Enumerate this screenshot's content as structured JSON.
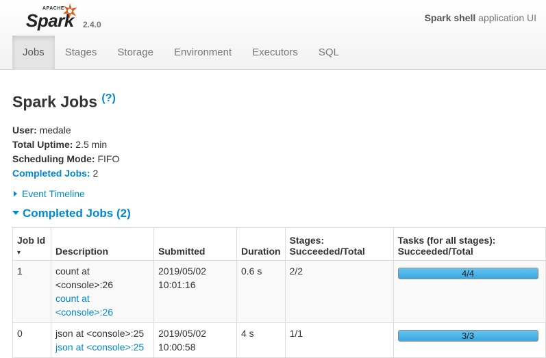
{
  "header": {
    "logo_apache": "APACHE",
    "logo_spark": "Spark",
    "version": "2.4.0",
    "app_name": "Spark shell",
    "app_suffix": " application UI"
  },
  "tabs": [
    {
      "label": "Jobs",
      "active": true
    },
    {
      "label": "Stages",
      "active": false
    },
    {
      "label": "Storage",
      "active": false
    },
    {
      "label": "Environment",
      "active": false
    },
    {
      "label": "Executors",
      "active": false
    },
    {
      "label": "SQL",
      "active": false
    }
  ],
  "page": {
    "title": "Spark Jobs",
    "help_open": "(",
    "help_q": "?",
    "help_close": ")"
  },
  "summary": {
    "user_label": "User:",
    "user_value": "medale",
    "uptime_label": "Total Uptime:",
    "uptime_value": "2.5 min",
    "mode_label": "Scheduling Mode:",
    "mode_value": "FIFO",
    "completed_label": "Completed Jobs:",
    "completed_value": "2"
  },
  "event_timeline": "Event Timeline",
  "completed_section": "Completed Jobs (2)",
  "table": {
    "headers": {
      "job_id": "Job Id",
      "sort_arrow": "▾",
      "description": "Description",
      "submitted": "Submitted",
      "duration": "Duration",
      "stages_l1": "Stages:",
      "stages_l2": "Succeeded/Total",
      "tasks_l1": "Tasks (for all stages):",
      "tasks_l2": "Succeeded/Total"
    },
    "rows": [
      {
        "job_id": "1",
        "desc": "count at <console>:26",
        "desc_link": "count at <console>:26",
        "submitted_date": "2019/05/02",
        "submitted_time": "10:01:16",
        "duration": "0.6 s",
        "stages": "2/2",
        "tasks": "4/4",
        "tasks_fraction": 1.0
      },
      {
        "job_id": "0",
        "desc": "json at <console>:25",
        "desc_link": "json at <console>:25",
        "submitted_date": "2019/05/02",
        "submitted_time": "10:00:58",
        "duration": "4 s",
        "stages": "1/1",
        "tasks": "3/3",
        "tasks_fraction": 1.0
      }
    ]
  },
  "colors": {
    "link": "#0088cc",
    "progress_fill": "#3aa7e0",
    "logo_star": "#e25a1c"
  },
  "icons": {
    "logo": "spark-star-icon",
    "timeline_toggle": "triangle-right-icon",
    "section_toggle": "triangle-down-icon"
  }
}
